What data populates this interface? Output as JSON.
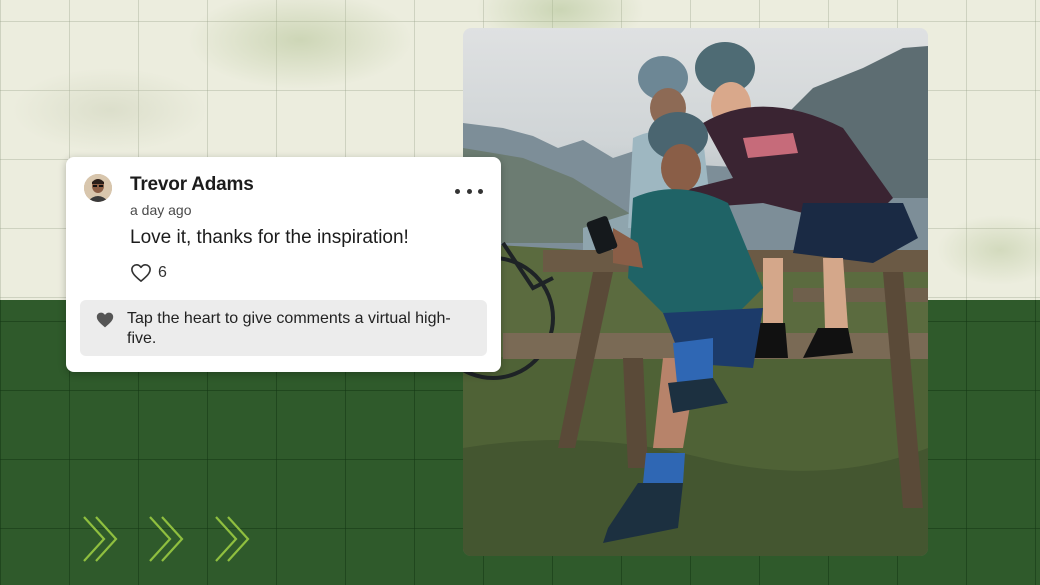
{
  "comment": {
    "author": "Trevor Adams",
    "timestamp": "a day ago",
    "text": "Love it, thanks for the inspiration!",
    "like_count": "6",
    "more_icon": "more-horizontal-icon",
    "like_icon": "heart-outline-icon"
  },
  "tip": {
    "icon": "heart-filled-icon",
    "text": "Tap the heart to give comments a virtual high-five."
  },
  "decor": {
    "chevron_icon": "chevron-right-icon",
    "chevron_color": "#8fbf3f"
  },
  "photo": {
    "subject": "cyclists-on-picnic-table-photo"
  },
  "colors": {
    "background_top": "#ecedde",
    "background_bottom": "#2f5a2b",
    "card": "#ffffff",
    "tip_background": "#ececec"
  }
}
